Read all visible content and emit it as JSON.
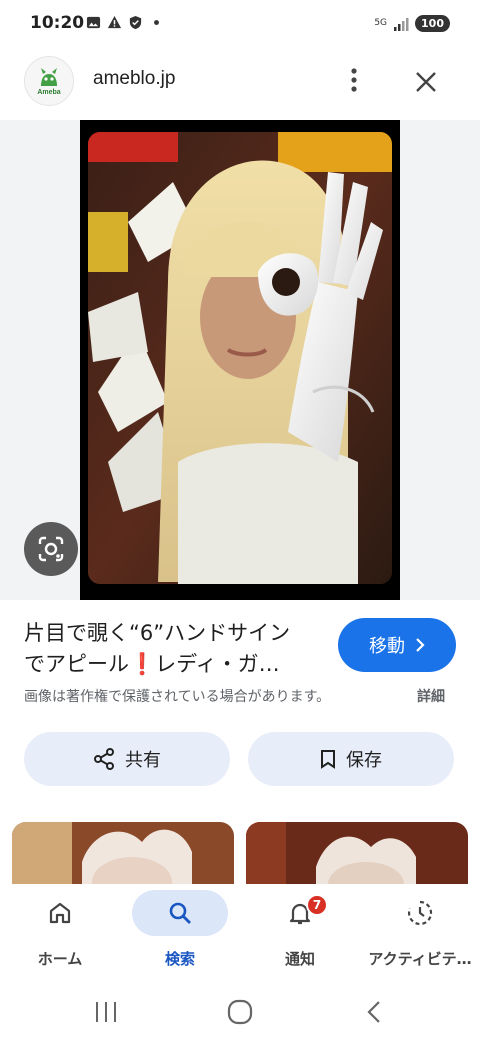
{
  "status_bar": {
    "time": "10:20",
    "network": "5G",
    "battery": "100"
  },
  "header": {
    "site_logo_text": "Ameba",
    "site_domain": "ameblo.jp"
  },
  "result": {
    "title_line1": "片目で覗く“6”ハンドサイン",
    "title_line2": "でアピール❗レディ・ガ…",
    "visit_label": "移動",
    "copyright_note": "画像は著作権で保護されている場合があります。",
    "details_label": "詳細"
  },
  "actions": {
    "share_label": "共有",
    "save_label": "保存"
  },
  "bottom_nav": {
    "home": "ホーム",
    "search": "検索",
    "notifications": "通知",
    "notifications_badge": "7",
    "activity": "アクティビテ…"
  },
  "colors": {
    "accent": "#1a73e8",
    "pill_bg": "#e8eef9",
    "nav_active_bg": "#dce6f9",
    "badge": "#d93025"
  }
}
